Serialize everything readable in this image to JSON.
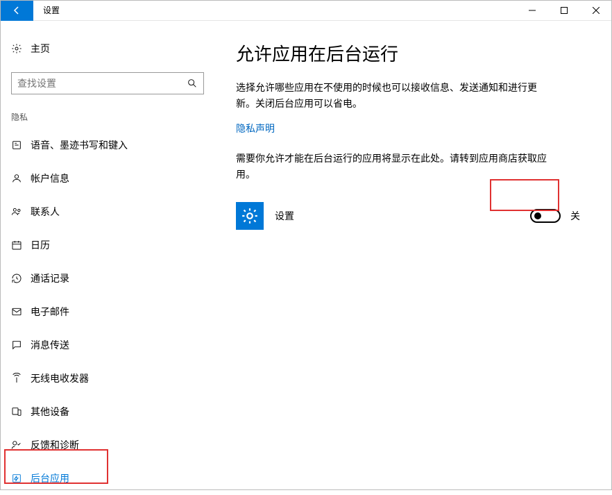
{
  "window": {
    "title": "设置"
  },
  "sidebar": {
    "home_label": "主页",
    "search_placeholder": "查找设置",
    "section_title": "隐私",
    "items": [
      {
        "label": "语音、墨迹书写和键入"
      },
      {
        "label": "帐户信息"
      },
      {
        "label": "联系人"
      },
      {
        "label": "日历"
      },
      {
        "label": "通话记录"
      },
      {
        "label": "电子邮件"
      },
      {
        "label": "消息传送"
      },
      {
        "label": "无线电收发器"
      },
      {
        "label": "其他设备"
      },
      {
        "label": "反馈和诊断"
      },
      {
        "label": "后台应用"
      }
    ]
  },
  "main": {
    "heading": "允许应用在后台运行",
    "description": "选择允许哪些应用在不使用的时候也可以接收信息、发送通知和进行更新。关闭后台应用可以省电。",
    "privacy_link": "隐私声明",
    "info": "需要你允许才能在后台运行的应用将显示在此处。请转到应用商店获取应用。",
    "app": {
      "name": "设置",
      "toggle_state": "关"
    }
  }
}
